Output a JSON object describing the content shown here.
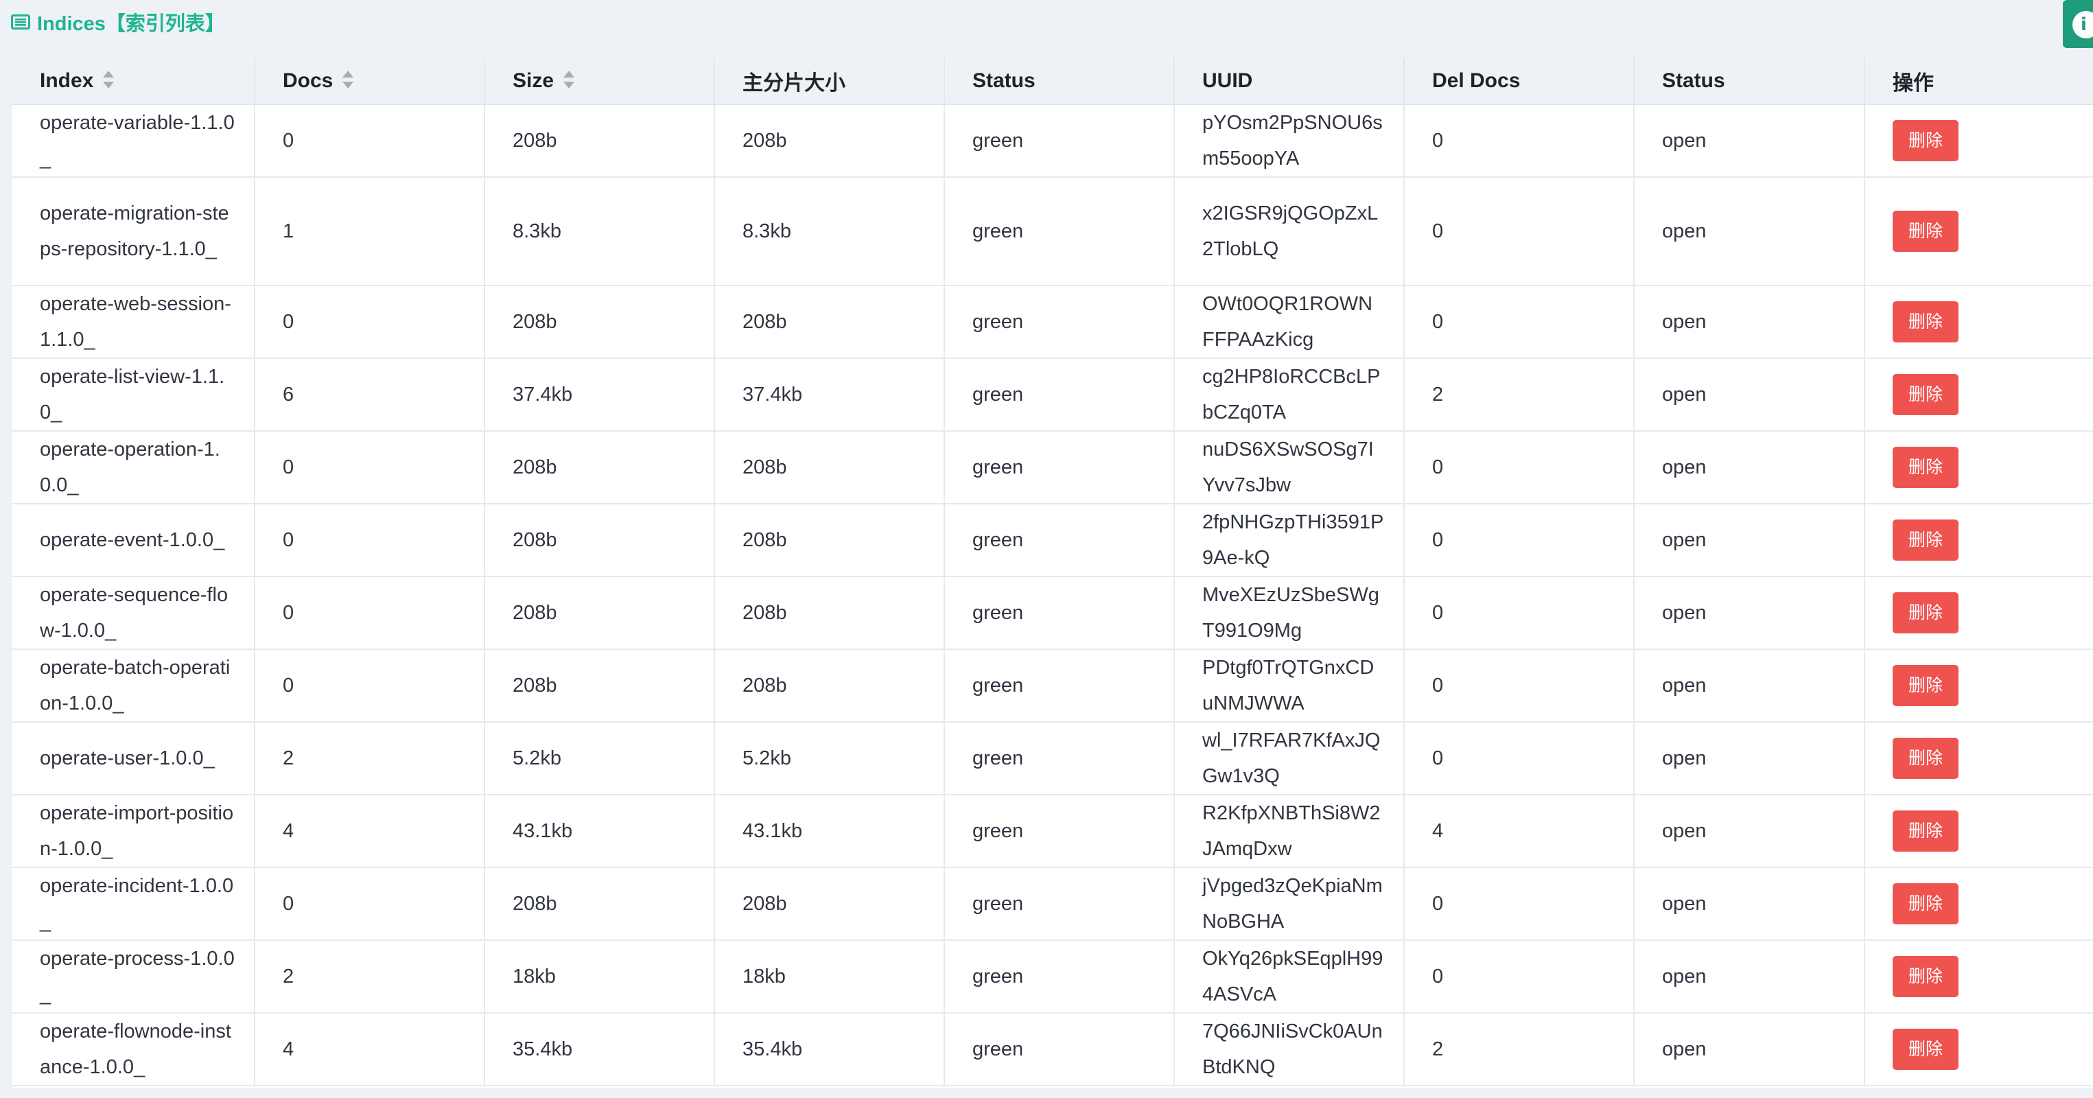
{
  "header": {
    "title": "Indices【索引列表】",
    "title_icon": "table-list-icon",
    "info_icon": "info-icon"
  },
  "colors": {
    "accent": "#1fb58f",
    "danger": "#ef5350",
    "header_bg": "#eef1f6"
  },
  "table": {
    "columns": [
      "Index",
      "Docs",
      "Size",
      "主分片大小",
      "Status",
      "UUID",
      "Del Docs",
      "Status",
      "操作"
    ],
    "sortable_columns": [
      "Index",
      "Docs",
      "Size"
    ],
    "delete_label": "删除",
    "rows": [
      {
        "index": "operate-variable-1.1.0_",
        "docs": "0",
        "size": "208b",
        "primary_size": "208b",
        "health": "green",
        "uuid": "pYOsm2PpSNOU6sm55oopYA",
        "del_docs": "0",
        "status": "open"
      },
      {
        "index": "operate-migration-steps-repository-1.1.0_",
        "docs": "1",
        "size": "8.3kb",
        "primary_size": "8.3kb",
        "health": "green",
        "uuid": "x2IGSR9jQGOpZxL2TlobLQ",
        "del_docs": "0",
        "status": "open"
      },
      {
        "index": "operate-web-session-1.1.0_",
        "docs": "0",
        "size": "208b",
        "primary_size": "208b",
        "health": "green",
        "uuid": "OWt0OQR1ROWNFFPAAzKicg",
        "del_docs": "0",
        "status": "open"
      },
      {
        "index": "operate-list-view-1.1.0_",
        "docs": "6",
        "size": "37.4kb",
        "primary_size": "37.4kb",
        "health": "green",
        "uuid": "cg2HP8IoRCCBcLPbCZq0TA",
        "del_docs": "2",
        "status": "open"
      },
      {
        "index": "operate-operation-1.0.0_",
        "docs": "0",
        "size": "208b",
        "primary_size": "208b",
        "health": "green",
        "uuid": "nuDS6XSwSOSg7IYvv7sJbw",
        "del_docs": "0",
        "status": "open"
      },
      {
        "index": "operate-event-1.0.0_",
        "docs": "0",
        "size": "208b",
        "primary_size": "208b",
        "health": "green",
        "uuid": "2fpNHGzpTHi3591P9Ae-kQ",
        "del_docs": "0",
        "status": "open"
      },
      {
        "index": "operate-sequence-flow-1.0.0_",
        "docs": "0",
        "size": "208b",
        "primary_size": "208b",
        "health": "green",
        "uuid": "MveXEzUzSbeSWgT991O9Mg",
        "del_docs": "0",
        "status": "open"
      },
      {
        "index": "operate-batch-operation-1.0.0_",
        "docs": "0",
        "size": "208b",
        "primary_size": "208b",
        "health": "green",
        "uuid": "PDtgf0TrQTGnxCDuNMJWWA",
        "del_docs": "0",
        "status": "open"
      },
      {
        "index": "operate-user-1.0.0_",
        "docs": "2",
        "size": "5.2kb",
        "primary_size": "5.2kb",
        "health": "green",
        "uuid": "wl_I7RFAR7KfAxJQGw1v3Q",
        "del_docs": "0",
        "status": "open"
      },
      {
        "index": "operate-import-position-1.0.0_",
        "docs": "4",
        "size": "43.1kb",
        "primary_size": "43.1kb",
        "health": "green",
        "uuid": "R2KfpXNBThSi8W2JAmqDxw",
        "del_docs": "4",
        "status": "open"
      },
      {
        "index": "operate-incident-1.0.0_",
        "docs": "0",
        "size": "208b",
        "primary_size": "208b",
        "health": "green",
        "uuid": "jVpged3zQeKpiaNmNoBGHA",
        "del_docs": "0",
        "status": "open"
      },
      {
        "index": "operate-process-1.0.0_",
        "docs": "2",
        "size": "18kb",
        "primary_size": "18kb",
        "health": "green",
        "uuid": "OkYq26pkSEqplH994ASVcA",
        "del_docs": "0",
        "status": "open"
      },
      {
        "index": "operate-flownode-instance-1.0.0_",
        "docs": "4",
        "size": "35.4kb",
        "primary_size": "35.4kb",
        "health": "green",
        "uuid": "7Q66JNIiSvCk0AUnBtdKNQ",
        "del_docs": "2",
        "status": "open"
      }
    ]
  }
}
